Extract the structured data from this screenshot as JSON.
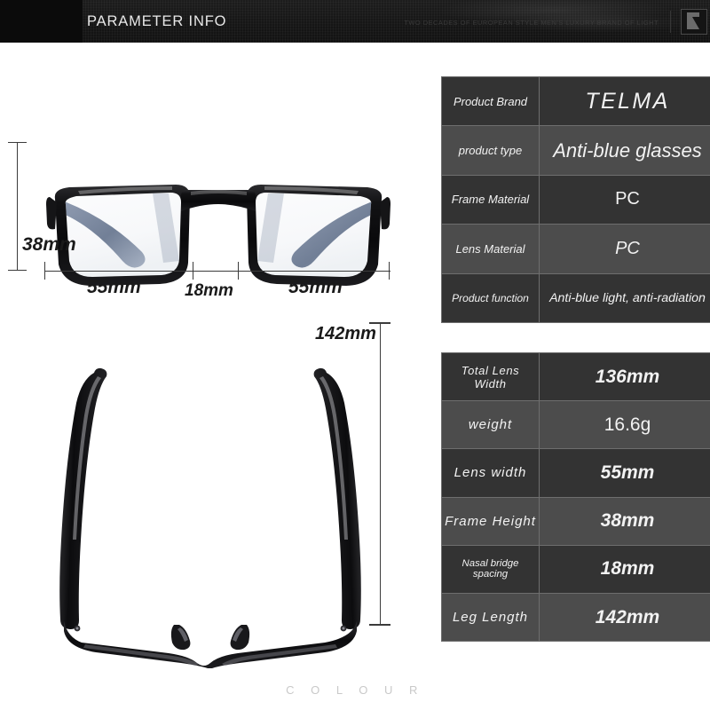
{
  "header": {
    "title": "PARAMETER INFO",
    "tagline": "TWO DECADES OF EUROPEAN STYLE MEN'S LUXURY BRAND OF LIGHT",
    "logo_icon": "brand-mark-icon"
  },
  "diagram": {
    "front_view": {
      "alt": "eyeglasses-front-view",
      "frame_height_label": "38mm",
      "lens_left_label": "55mm",
      "bridge_label": "18mm",
      "lens_right_label": "55mm"
    },
    "bottom_view": {
      "alt": "eyeglasses-bottom-view",
      "temple_length_label": "142mm"
    }
  },
  "spec_table_primary": {
    "rows": [
      {
        "key": "Product Brand",
        "value": "TELMA"
      },
      {
        "key": "product type",
        "value": "Anti-blue glasses"
      },
      {
        "key": "Frame Material",
        "value": "PC"
      },
      {
        "key": "Lens Material",
        "value": "PC"
      },
      {
        "key": "Product function",
        "value": "Anti-blue light, anti-radiation"
      }
    ]
  },
  "spec_table_dimensions": {
    "rows": [
      {
        "key": "Total Lens Width",
        "value": "136mm"
      },
      {
        "key": "weight",
        "value": "16.6g"
      },
      {
        "key": "Lens width",
        "value": "55mm"
      },
      {
        "key": "Frame Height",
        "value": "38mm"
      },
      {
        "key": "Nasal bridge spacing",
        "value": "18mm"
      },
      {
        "key": "Leg Length",
        "value": "142mm"
      }
    ]
  },
  "footer": {
    "colour_label": "C O L O U R"
  },
  "colors": {
    "header_bg": "#0b0b0b",
    "row_dark": "#333333",
    "row_light": "#4c4c4c",
    "text_light": "#f2f2f2",
    "page_bg": "#ffffff"
  }
}
